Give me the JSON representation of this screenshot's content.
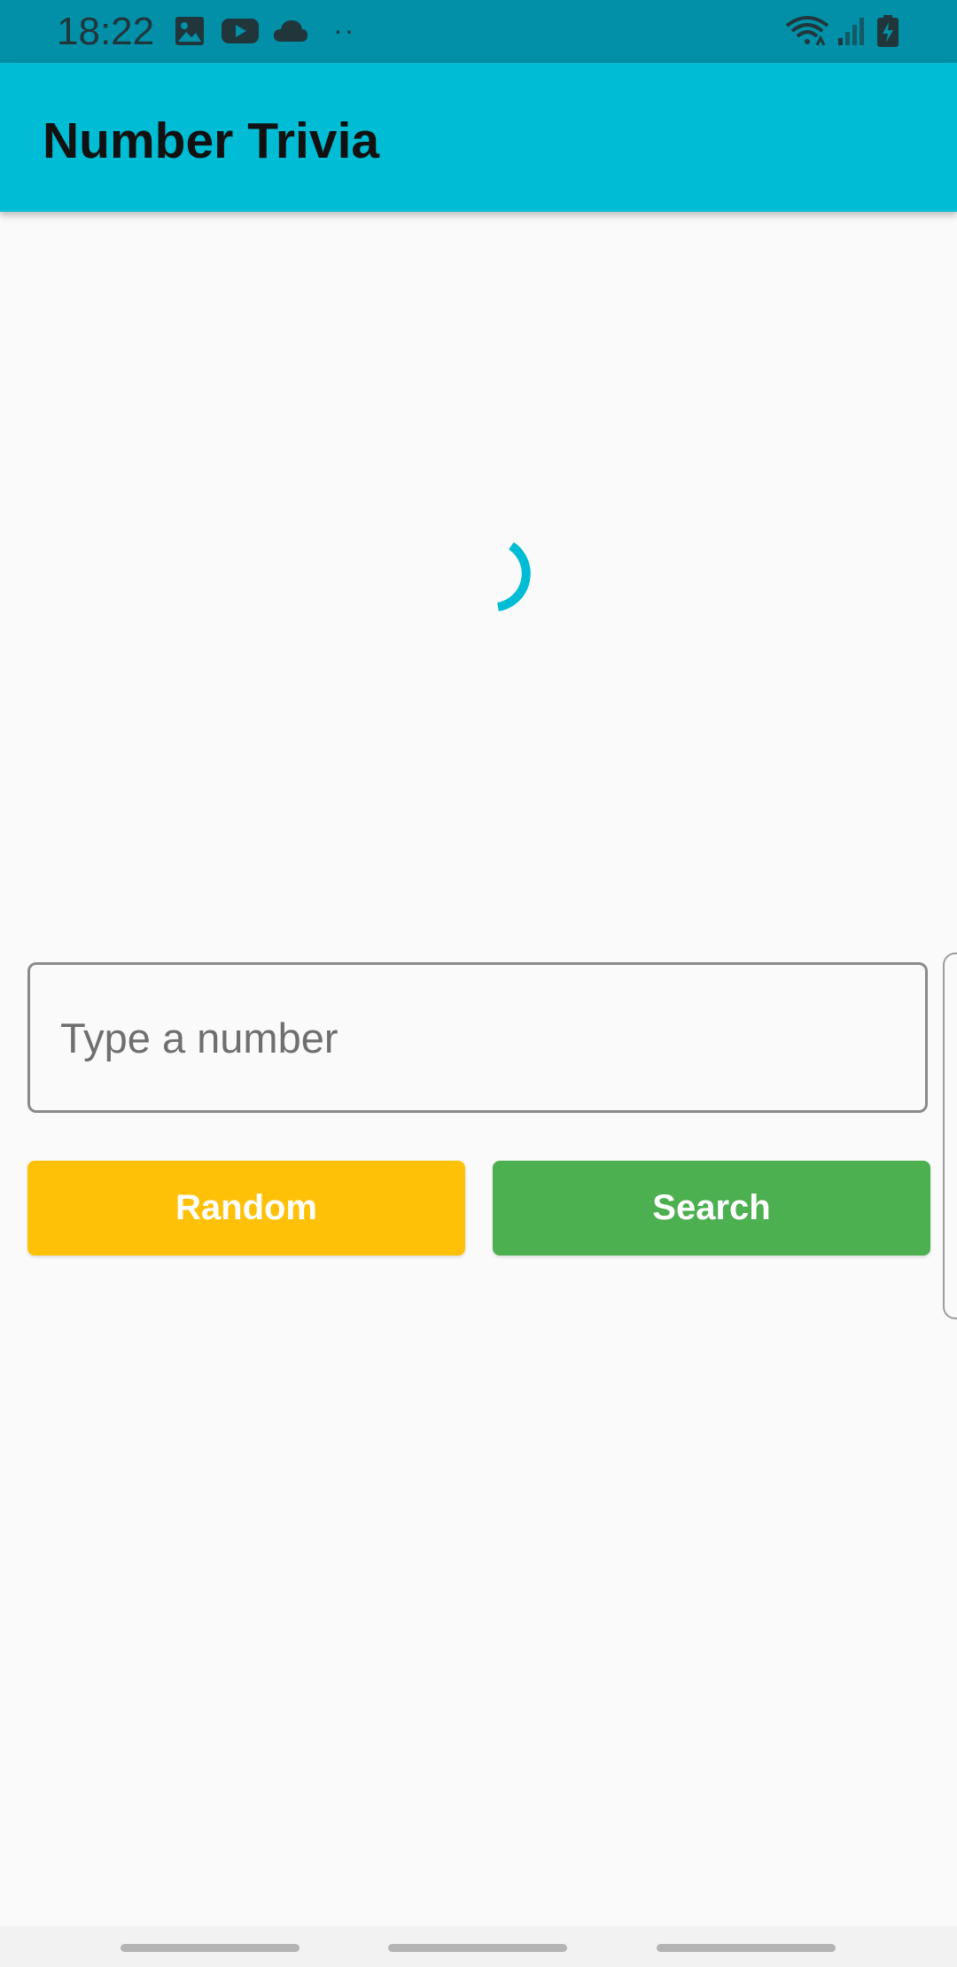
{
  "status_bar": {
    "time": "18:22",
    "dots": "··",
    "icons": [
      "image-icon",
      "youtube-icon",
      "cloud-icon",
      "wifi-icon",
      "signal-icon",
      "battery-charging-icon"
    ]
  },
  "app_bar": {
    "title": "Number Trivia"
  },
  "loading": {
    "state": "loading",
    "color": "#00bcd4"
  },
  "input": {
    "value": "",
    "placeholder": "Type a number"
  },
  "buttons": {
    "random_label": "Random",
    "search_label": "Search"
  },
  "colors": {
    "status_bar": "#0190a8",
    "app_bar": "#00bcd4",
    "random_button": "#ffc107",
    "search_button": "#4caf50",
    "background": "#fafafa"
  }
}
